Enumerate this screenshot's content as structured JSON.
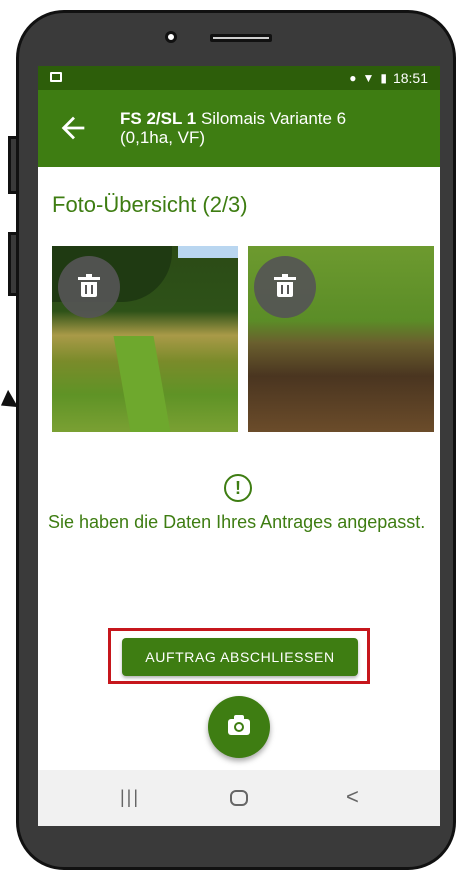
{
  "status_bar": {
    "time": "18:51",
    "icons": [
      "image-icon",
      "location-icon",
      "wifi-icon",
      "battery-icon"
    ]
  },
  "app_bar": {
    "title_bold": "FS 2/SL 1",
    "title_rest": " Silomais Variante 6",
    "subtitle": "(0,1ha, VF)"
  },
  "section_title": "Foto-Übersicht (2/3)",
  "photos": [
    {
      "icon": "trash-icon"
    },
    {
      "icon": "trash-icon"
    }
  ],
  "notice": {
    "icon_glyph": "!",
    "text": "Sie haben die Daten Ihres Antrages angepasst."
  },
  "primary_button": {
    "label": "AUFTRAG ABSCHLIESSEN"
  },
  "fab": {
    "icon": "camera-icon"
  },
  "nav_bar": {
    "recent": "|||",
    "back": "<"
  },
  "colors": {
    "primary": "#3e7d12",
    "status_bar": "#2d5e0a",
    "highlight": "#c6161c"
  }
}
